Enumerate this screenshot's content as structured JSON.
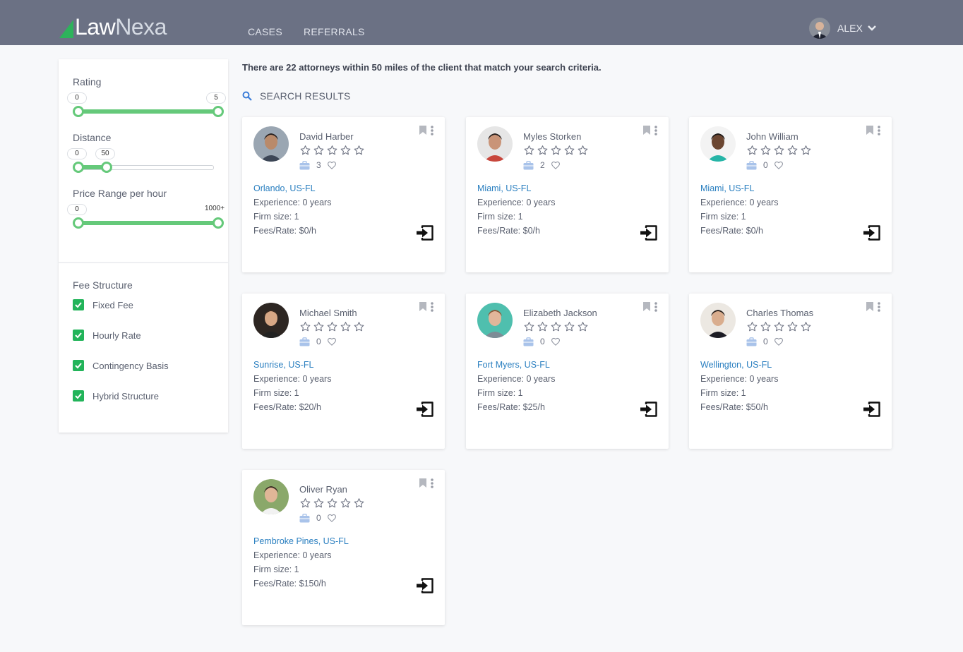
{
  "header": {
    "logo": {
      "part1": "Law",
      "part2": "Nexa"
    },
    "nav": [
      "CASES",
      "REFERRALS"
    ],
    "user": {
      "name": "ALEX"
    }
  },
  "filters": {
    "rating": {
      "label": "Rating",
      "min": "0",
      "max": "5"
    },
    "distance": {
      "label": "Distance",
      "min": "0",
      "max": "50"
    },
    "price": {
      "label": "Price Range per hour",
      "min": "0",
      "max": "1000+"
    },
    "fee_structure": {
      "label": "Fee Structure",
      "options": [
        "Fixed Fee",
        "Hourly Rate",
        "Contingency Basis",
        "Hybrid Structure"
      ]
    }
  },
  "results": {
    "summary": "There are 22 attorneys within 50 miles of the client that match your search criteria.",
    "search_label": "SEARCH RESULTS"
  },
  "attorneys": [
    {
      "name": "David Harber",
      "cases": "3",
      "location": "Orlando, US-FL",
      "experience": "Experience: 0 years",
      "firm": "Firm size: 1",
      "fees": "Fees/Rate: $0/h"
    },
    {
      "name": "Myles Storken",
      "cases": "2",
      "location": "Miami, US-FL",
      "experience": "Experience: 0 years",
      "firm": "Firm size: 1",
      "fees": "Fees/Rate: $0/h"
    },
    {
      "name": "John William",
      "cases": "0",
      "location": "Miami, US-FL",
      "experience": "Experience: 0 years",
      "firm": "Firm size: 1",
      "fees": "Fees/Rate: $0/h"
    },
    {
      "name": "Michael Smith",
      "cases": "0",
      "location": "Sunrise, US-FL",
      "experience": "Experience: 0 years",
      "firm": "Firm size: 1",
      "fees": "Fees/Rate: $20/h"
    },
    {
      "name": "Elizabeth Jackson",
      "cases": "0",
      "location": "Fort Myers, US-FL",
      "experience": "Experience: 0 years",
      "firm": "Firm size: 1",
      "fees": "Fees/Rate: $25/h"
    },
    {
      "name": "Charles Thomas",
      "cases": "0",
      "location": "Wellington, US-FL",
      "experience": "Experience: 0 years",
      "firm": "Firm size: 1",
      "fees": "Fees/Rate: $50/h"
    },
    {
      "name": "Oliver Ryan",
      "cases": "0",
      "location": "Pembroke Pines, US-FL",
      "experience": "Experience: 0 years",
      "firm": "Firm size: 1",
      "fees": "Fees/Rate: $150/h"
    }
  ]
}
